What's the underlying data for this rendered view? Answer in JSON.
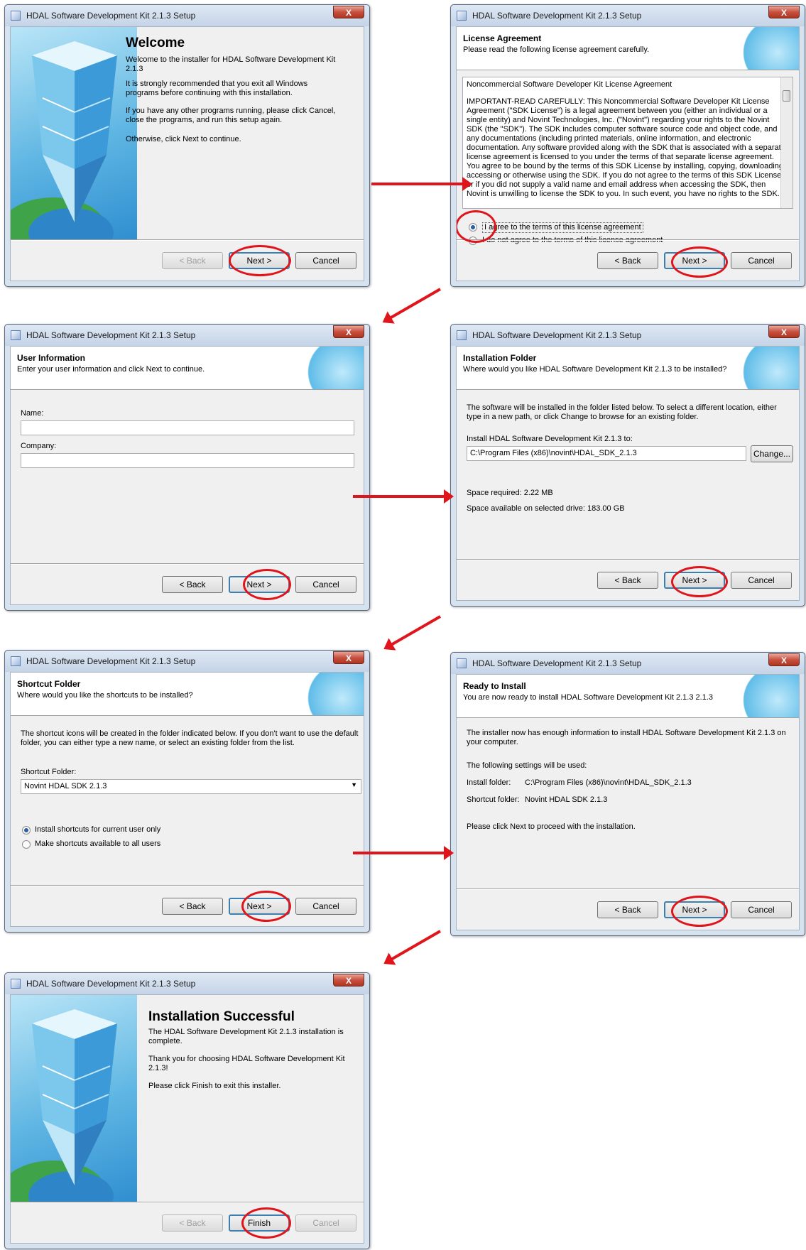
{
  "window_title": "HDAL Software Development Kit 2.1.3 Setup",
  "close_symbol": "X",
  "buttons": {
    "back": "< Back",
    "next": "Next >",
    "cancel": "Cancel",
    "finish": "Finish",
    "change": "Change..."
  },
  "welcome": {
    "heading": "Welcome",
    "p1": "Welcome to the installer for HDAL Software Development Kit 2.1.3",
    "p2": "It is strongly recommended that you exit all Windows programs before continuing with this installation.",
    "p3": "If you have any other programs running, please click Cancel, close the programs, and run this setup again.",
    "p4": "Otherwise, click Next to continue."
  },
  "license": {
    "title": "License Agreement",
    "subtitle": "Please read the following license agreement carefully.",
    "text_title": "Noncommercial Software Developer Kit License Agreement",
    "text_body": "IMPORTANT-READ CAREFULLY: This Noncommercial Software Developer Kit License Agreement (\"SDK License\") is a legal agreement between you (either an individual or a single entity) and Novint Technologies, Inc. (\"Novint\") regarding your rights to the Novint SDK (the \"SDK\"). The SDK includes computer software source code and object code, and any documentations (including printed materials, online information, and electronic documentation. Any software provided along with the SDK that is associated with a separate license agreement is licensed to you under the terms of that separate license agreement. You agree to be bound by the terms of this SDK License by installing, copying, downloading, accessing or otherwise using the SDK. If you do not agree to the terms of this SDK License, or if you did not supply a valid name and email address when accessing the SDK, then Novint is unwilling to license the SDK to you. In such event, you have no rights to the SDK.",
    "agree": "I agree to the terms of this license agreement",
    "disagree": "I do not agree to the terms of this license agreement"
  },
  "user_info": {
    "title": "User Information",
    "subtitle": "Enter your user information and click Next to continue.",
    "name_label": "Name:",
    "name_value": "",
    "company_label": "Company:",
    "company_value": ""
  },
  "install_folder": {
    "title": "Installation Folder",
    "subtitle": "Where would you like HDAL Software Development Kit 2.1.3 to be installed?",
    "desc": "The software will be installed in the folder listed below. To select a different location, either type in a new path, or click Change to browse for an existing folder.",
    "label": "Install HDAL Software Development Kit 2.1.3 to:",
    "path": "C:\\Program Files (x86)\\novint\\HDAL_SDK_2.1.3",
    "space_required": "Space required: 2.22 MB",
    "space_available": "Space available on selected drive: 183.00 GB"
  },
  "shortcut_folder": {
    "title": "Shortcut Folder",
    "subtitle": "Where would you like the shortcuts to be installed?",
    "desc": "The shortcut icons will be created in the folder indicated below. If you don't want to use the default folder, you can either type a new name, or select an existing folder from the list.",
    "label": "Shortcut Folder:",
    "value": "Novint HDAL SDK 2.1.3",
    "opt_current": "Install shortcuts for current user only",
    "opt_all": "Make shortcuts available to all users"
  },
  "ready": {
    "title": "Ready to Install",
    "subtitle": "You are now ready to install HDAL Software Development Kit 2.1.3 2.1.3",
    "desc": "The installer now has enough information to install HDAL Software Development Kit 2.1.3 on your computer.",
    "settings": "The following settings will be used:",
    "install_folder_label": "Install folder:",
    "install_folder_value": "C:\\Program Files (x86)\\novint\\HDAL_SDK_2.1.3",
    "shortcut_folder_label": "Shortcut folder:",
    "shortcut_folder_value": "Novint HDAL SDK 2.1.3",
    "proceed": "Please click Next to proceed with the installation."
  },
  "success": {
    "heading": "Installation Successful",
    "p1": "The HDAL Software Development Kit 2.1.3 installation is complete.",
    "p2": "Thank you for choosing HDAL Software Development Kit 2.1.3!",
    "p3": "Please click Finish to exit this installer."
  },
  "colors": {
    "annotation": "#e0151b",
    "default_button_border": "#3c7fb1",
    "close_button": "#c75040"
  }
}
